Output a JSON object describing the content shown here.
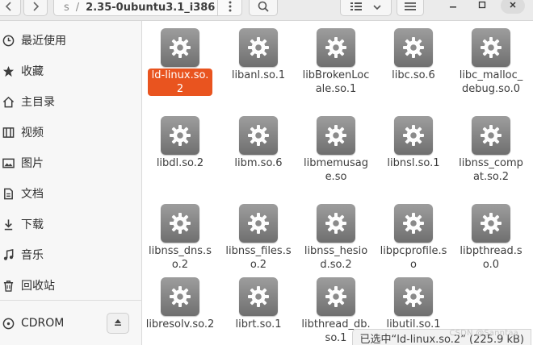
{
  "header": {
    "back_icon": "chevron-left-icon",
    "forward_icon": "chevron-right-icon",
    "path_prefix": "s",
    "path_current": "2.35-0ubuntu3.1_i386",
    "menu_icon": "kebab-menu-icon",
    "search_icon": "search-icon",
    "view_list_icon": "list-view-icon",
    "view_dropdown_icon": "chevron-down-icon",
    "hamburger_icon": "hamburger-menu-icon",
    "minimize_icon": "minimize-icon",
    "maximize_icon": "maximize-icon",
    "close_icon": "close-icon"
  },
  "sidebar": {
    "items": [
      {
        "label": "最近使用",
        "icon": "clock-icon"
      },
      {
        "label": "收藏",
        "icon": "star-icon"
      },
      {
        "label": "主目录",
        "icon": "home-icon"
      },
      {
        "label": "视频",
        "icon": "film-icon"
      },
      {
        "label": "图片",
        "icon": "image-icon"
      },
      {
        "label": "文档",
        "icon": "document-icon"
      },
      {
        "label": "下载",
        "icon": "download-icon"
      },
      {
        "label": "音乐",
        "icon": "music-icon"
      },
      {
        "label": "回收站",
        "icon": "trash-icon"
      }
    ],
    "device": {
      "label": "CDROM",
      "icon": "disc-icon",
      "eject_icon": "eject-icon"
    }
  },
  "files": [
    {
      "name": "ld-linux.so.2",
      "selected": true
    },
    {
      "name": "libanl.so.1"
    },
    {
      "name": "libBrokenLocale.so.1"
    },
    {
      "name": "libc.so.6"
    },
    {
      "name": "libc_malloc_debug.so.0"
    },
    {
      "name": "libdl.so.2"
    },
    {
      "name": "libm.so.6"
    },
    {
      "name": "libmemusage.so"
    },
    {
      "name": "libnsl.so.1"
    },
    {
      "name": "libnss_compat.so.2"
    },
    {
      "name": "libnss_dns.so.2"
    },
    {
      "name": "libnss_files.so.2"
    },
    {
      "name": "libnss_hesiod.so.2"
    },
    {
      "name": "libpcprofile.so"
    },
    {
      "name": "libpthread.so.0"
    },
    {
      "name": "libresolv.so.2"
    },
    {
      "name": "librt.so.1"
    },
    {
      "name": "libthread_db.so.1"
    },
    {
      "name": "libutil.so.1"
    }
  ],
  "file_icon": "gear-file-icon",
  "status": {
    "text": "已选中“ld-linux.so.2” (225.9 kB)"
  },
  "watermark": "CSDN @Sanntaa"
}
